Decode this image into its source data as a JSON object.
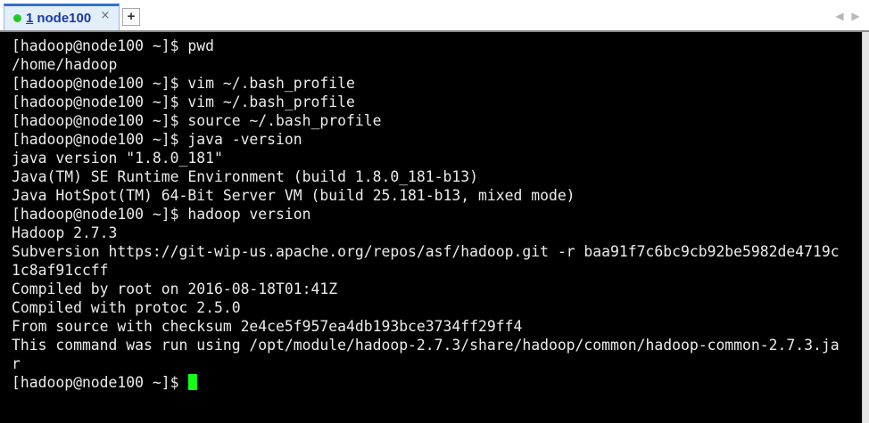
{
  "tab": {
    "number": "1",
    "label": "node100",
    "close_symbol": "×",
    "status_color": "#22c922"
  },
  "tabbar": {
    "add_symbol": "+",
    "scroll_left": "◀",
    "scroll_right": "▶"
  },
  "terminal": {
    "lines": [
      "[hadoop@node100 ~]$ pwd",
      "/home/hadoop",
      "[hadoop@node100 ~]$ vim ~/.bash_profile",
      "[hadoop@node100 ~]$ vim ~/.bash_profile",
      "[hadoop@node100 ~]$ source ~/.bash_profile",
      "[hadoop@node100 ~]$ java -version",
      "java version \"1.8.0_181\"",
      "Java(TM) SE Runtime Environment (build 1.8.0_181-b13)",
      "Java HotSpot(TM) 64-Bit Server VM (build 25.181-b13, mixed mode)",
      "[hadoop@node100 ~]$ hadoop version",
      "Hadoop 2.7.3",
      "Subversion https://git-wip-us.apache.org/repos/asf/hadoop.git -r baa91f7c6bc9cb92be5982de4719c",
      "1c8af91ccff",
      "Compiled by root on 2016-08-18T01:41Z",
      "Compiled with protoc 2.5.0",
      "From source with checksum 2e4ce5f957ea4db193bce3734ff29ff4",
      "This command was run using /opt/module/hadoop-2.7.3/share/hadoop/common/hadoop-common-2.7.3.ja",
      "r"
    ],
    "prompt": "[hadoop@node100 ~]$ ",
    "background_color": "#000000",
    "text_color": "#ececec",
    "cursor_color": "#14ff14"
  }
}
